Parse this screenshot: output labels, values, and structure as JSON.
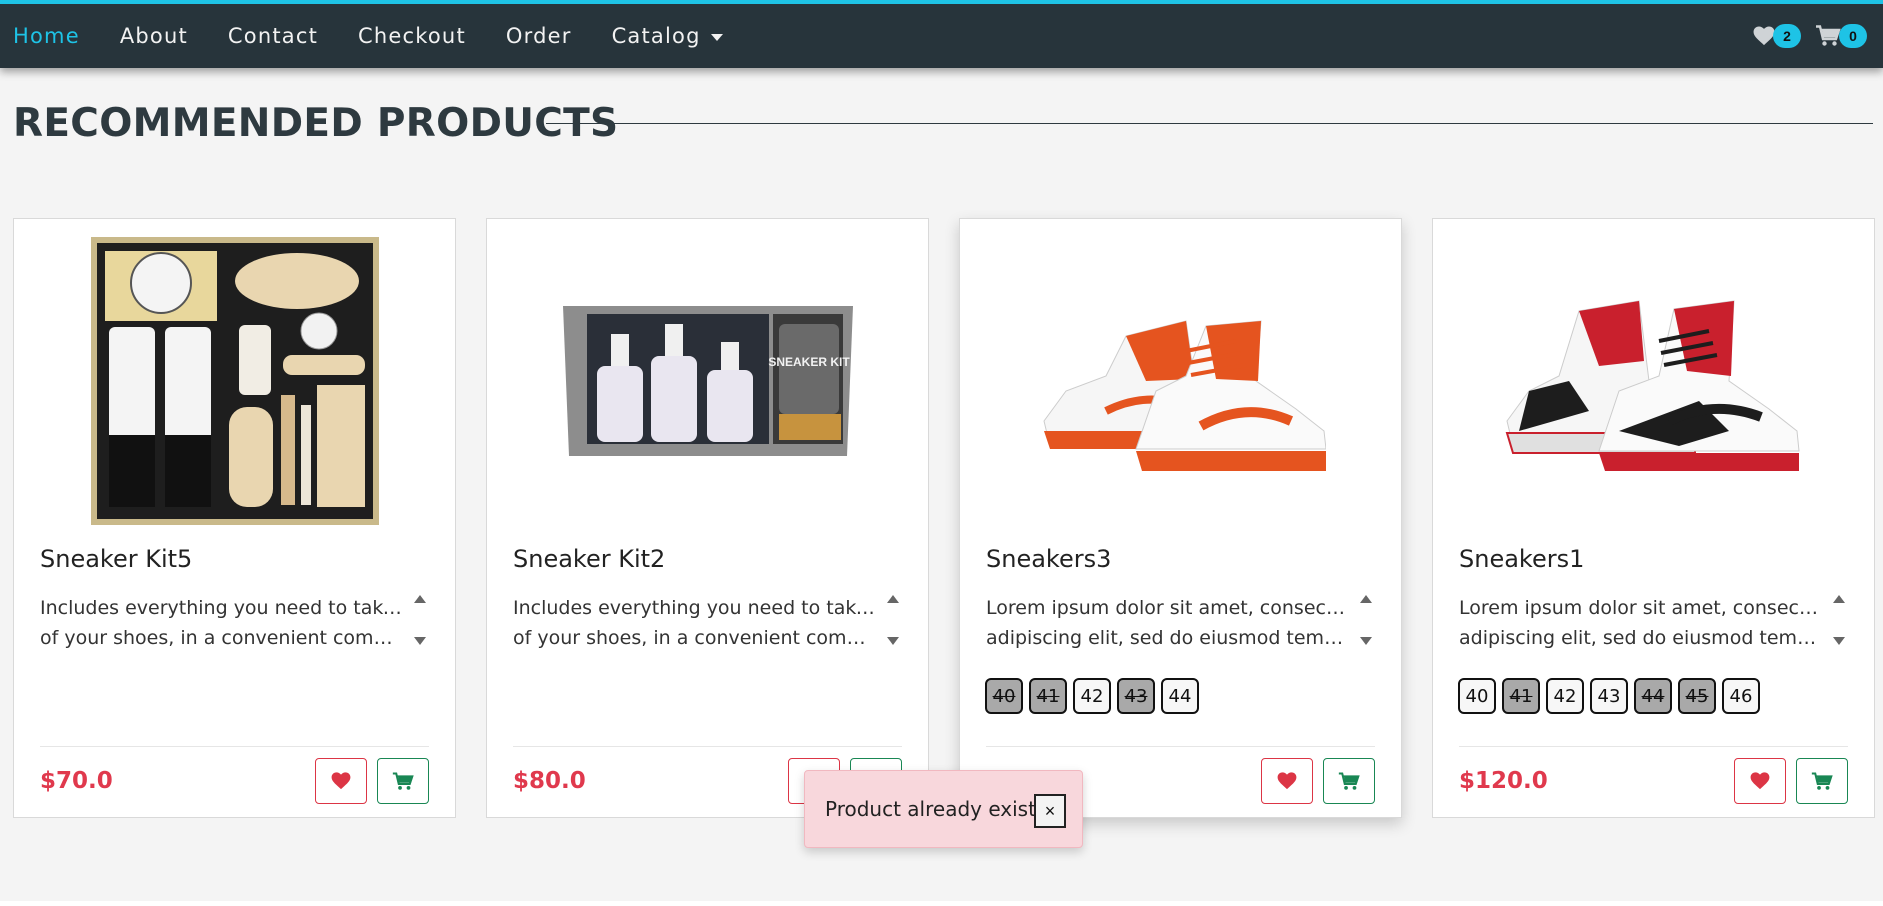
{
  "nav": {
    "items": [
      {
        "label": "Home",
        "active": true
      },
      {
        "label": "About"
      },
      {
        "label": "Contact"
      },
      {
        "label": "Checkout"
      },
      {
        "label": "Order"
      },
      {
        "label": "Catalog",
        "dropdown": true
      }
    ],
    "wishlist_icon": "heart-icon",
    "wishlist_count": "2",
    "cart_icon": "cart-icon",
    "cart_count": "0",
    "accent_color": "#1ec3e6",
    "bg_color": "#27343b"
  },
  "section": {
    "title": "RECOMMENDED PRODUCTS"
  },
  "products": [
    {
      "name": "Sneaker Kit5",
      "desc_line1": "Includes everything you need to take care",
      "desc_line2": "of your shoes, in a convenient compact…",
      "sizes": [],
      "price": "$70.0",
      "image": "shoe-care-kit-box-image"
    },
    {
      "name": "Sneaker Kit2",
      "desc_line1": "Includes everything you need to take care",
      "desc_line2": "of your shoes, in a convenient compact…",
      "sizes": [],
      "price": "$80.0",
      "image": "timberland-sneaker-kit-image",
      "image_text": "SNEAKER KIT"
    },
    {
      "name": "Sneakers3",
      "desc_line1": "Lorem ipsum dolor sit amet, consectetur",
      "desc_line2": "adipiscing elit, sed do eiusmod tempor…",
      "sizes": [
        {
          "label": "40",
          "available": false
        },
        {
          "label": "41",
          "available": false
        },
        {
          "label": "42",
          "available": true
        },
        {
          "label": "43",
          "available": false
        },
        {
          "label": "44",
          "available": true
        }
      ],
      "price": "",
      "image": "orange-white-dunk-sneakers-image"
    },
    {
      "name": "Sneakers1",
      "desc_line1": "Lorem ipsum dolor sit amet, consectetur",
      "desc_line2": "adipiscing elit, sed do eiusmod tempor…",
      "sizes": [
        {
          "label": "40",
          "available": true
        },
        {
          "label": "41",
          "available": false
        },
        {
          "label": "42",
          "available": true
        },
        {
          "label": "43",
          "available": true
        },
        {
          "label": "44",
          "available": false
        },
        {
          "label": "45",
          "available": false
        },
        {
          "label": "46",
          "available": true
        }
      ],
      "price": "$120.0",
      "image": "red-black-jordan-sneakers-image"
    }
  ],
  "toast": {
    "message": "Product already exists!",
    "close_label": "×",
    "bg_color": "#f8d7dc"
  },
  "colors": {
    "price": "#e0394d",
    "heart_button": "#dc3545",
    "cart_button": "#198754"
  }
}
